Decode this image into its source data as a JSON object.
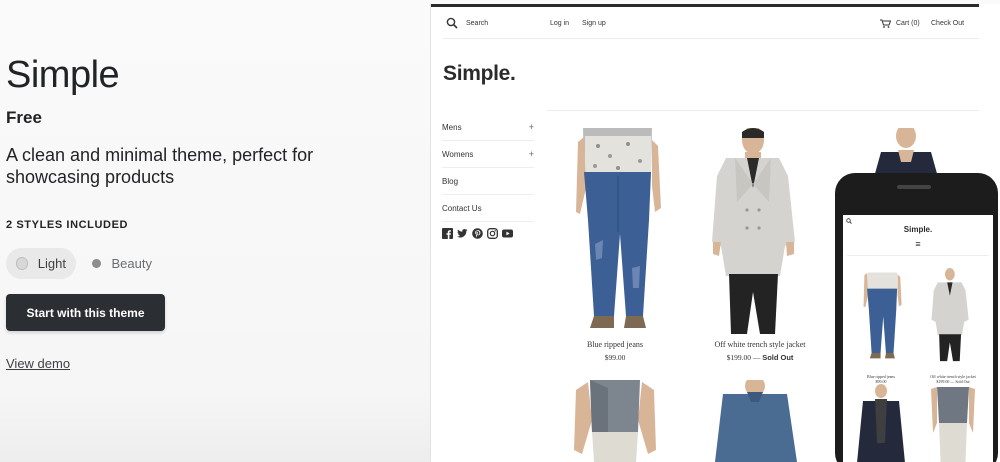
{
  "theme": {
    "title": "Simple",
    "price": "Free",
    "description": "A clean and minimal theme, perfect for showcasing products",
    "styles_heading": "2 STYLES INCLUDED",
    "styles": [
      {
        "label": "Light",
        "selected": true
      },
      {
        "label": "Beauty",
        "selected": false
      }
    ],
    "start_button": "Start with this theme",
    "view_demo": "View demo"
  },
  "store": {
    "search": "Search",
    "login": "Log in",
    "signup": "Sign up",
    "cart": "Cart (0)",
    "checkout": "Check Out",
    "brand": "Simple.",
    "nav": [
      {
        "label": "Mens",
        "expandable": "+"
      },
      {
        "label": "Womens",
        "expandable": "+"
      },
      {
        "label": "Blog",
        "expandable": ""
      },
      {
        "label": "Contact Us",
        "expandable": ""
      }
    ],
    "social_icons": [
      "facebook-icon",
      "twitter-icon",
      "pinterest-icon",
      "instagram-icon",
      "youtube-icon"
    ],
    "products": [
      {
        "name": "Blue ripped jeans",
        "price": "$99.00",
        "status": ""
      },
      {
        "name": "Off white trench style jacket",
        "price": "$199.00 —",
        "status": "Sold Out"
      }
    ]
  },
  "phone": {
    "brand": "Simple.",
    "menu_icon": "≡",
    "products": [
      {
        "name": "Blue ripped jeans",
        "price": "$99.00"
      },
      {
        "name": "Off white trench style jacket",
        "price": "$199.00 — Sold Out"
      }
    ]
  },
  "colors": {
    "primary_button": "#2b2e32",
    "text": "#212326",
    "denim": "#3c5f95"
  }
}
